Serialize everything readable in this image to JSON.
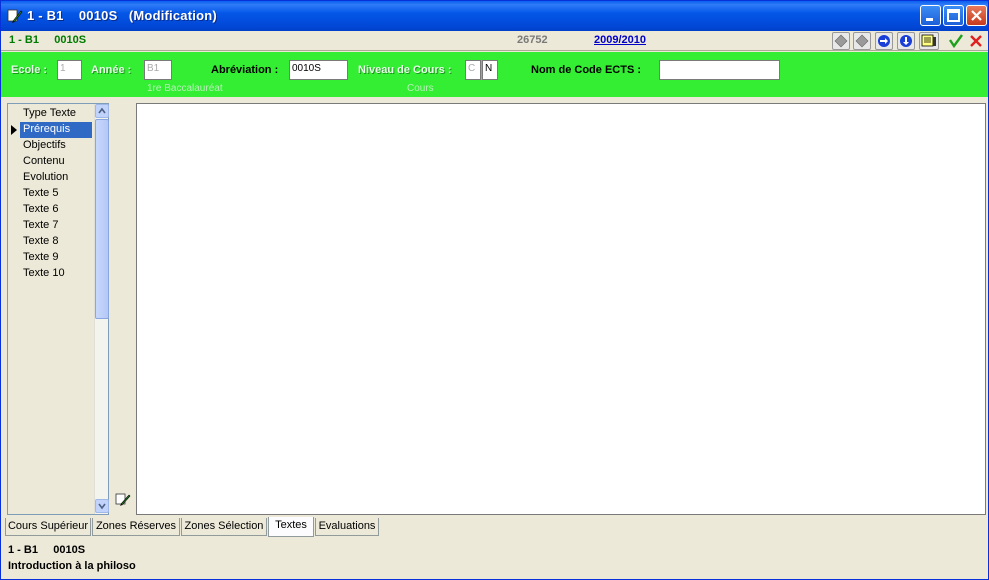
{
  "window": {
    "title": "1 - B1    0010S   (Modification)"
  },
  "infobar": {
    "code": "1 - B1     0010S",
    "record_id": "26752",
    "year": "2009/2010",
    "colors": {
      "code": "#007a00",
      "year_link": "#0000c8"
    }
  },
  "header": {
    "ecole_label": "Ecole :",
    "ecole_value": "1",
    "annee_label": "Année :",
    "annee_value": "B1",
    "annee_sub": "1re Baccalauréat",
    "abreviation_label": "Abréviation :",
    "abreviation_value": "0010S",
    "niveau_label": "Niveau de Cours :",
    "niveau_value_1": "C",
    "niveau_value_2": "N",
    "niveau_sub": "Cours",
    "ects_label": "Nom de Code ECTS :",
    "ects_value": "",
    "colors": {
      "background": "#33ee33"
    }
  },
  "list": {
    "items": [
      {
        "label": "Type Texte"
      },
      {
        "label": "Prérequis"
      },
      {
        "label": "Objectifs"
      },
      {
        "label": "Contenu"
      },
      {
        "label": "Evolution"
      },
      {
        "label": "Texte 5"
      },
      {
        "label": "Texte 6"
      },
      {
        "label": "Texte 7"
      },
      {
        "label": "Texte 8"
      },
      {
        "label": "Texte 9"
      },
      {
        "label": "Texte 10"
      }
    ],
    "selected_index": 1,
    "colors": {
      "selected": "#316ac5"
    }
  },
  "editor": {
    "content": ""
  },
  "tabs": [
    {
      "label": "Cours Supérieur"
    },
    {
      "label": "Zones Réserves"
    },
    {
      "label": "Zones Sélection"
    },
    {
      "label": "Textes"
    },
    {
      "label": "Evaluations"
    }
  ],
  "active_tab_index": 3,
  "footer": {
    "code": "1 - B1     0010S",
    "course_title": "Introduction à la philoso"
  },
  "icons": {
    "title": "app-pen-icon",
    "nav": [
      "first-record-icon",
      "previous-record-icon",
      "next-record-icon",
      "last-record-icon",
      "memo-icon",
      "confirm-check-icon",
      "cancel-x-icon"
    ],
    "edit": "edit-pen-icon"
  }
}
